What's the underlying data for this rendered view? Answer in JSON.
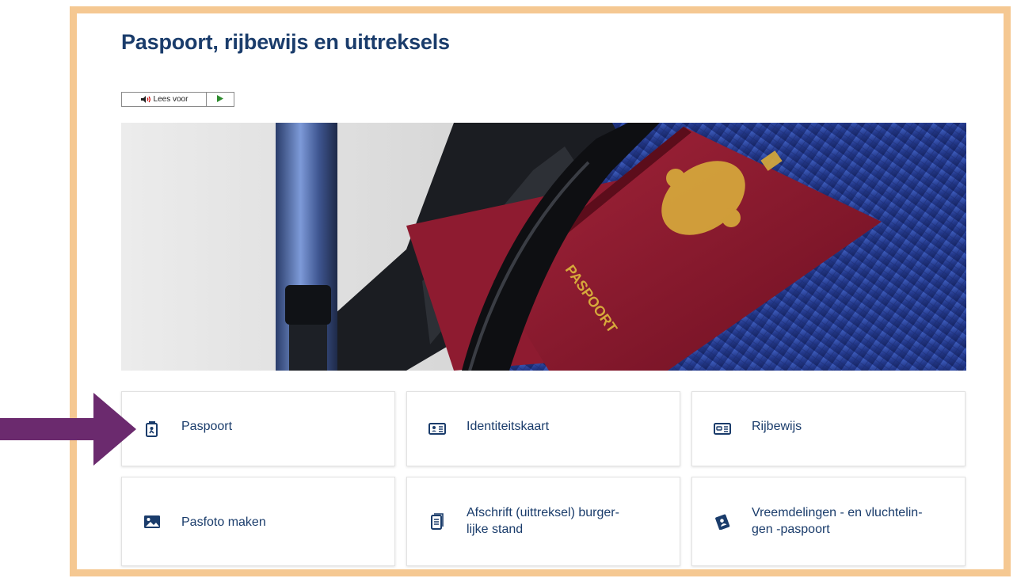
{
  "page": {
    "title": "Paspoort, rijbewijs en uittreksels"
  },
  "readspeaker": {
    "label": "Lees voor",
    "speaker_icon": "speaker-icon",
    "play_icon": "play-icon"
  },
  "hero": {
    "alt": "Foto van Nederlandse paspoorten op een koffer",
    "passport_text": "PASPOORT"
  },
  "tiles": [
    {
      "label": "Paspoort",
      "icon": "passport-icon"
    },
    {
      "label": "Identiteitskaart",
      "icon": "id-card-icon"
    },
    {
      "label": "Rijbewijs",
      "icon": "driving-license-icon"
    },
    {
      "label": "Pasfoto maken",
      "icon": "photo-icon"
    },
    {
      "label": "Afschrift (uittreksel) burger-\nlijke stand",
      "icon": "document-icon"
    },
    {
      "label": "Vreemdelingen - en vluchtelin-\ngen -paspoort",
      "icon": "refugee-passport-icon"
    }
  ],
  "colors": {
    "frame": "#f5c892",
    "heading": "#1a3c6b",
    "arrow": "#6b2a6e"
  }
}
